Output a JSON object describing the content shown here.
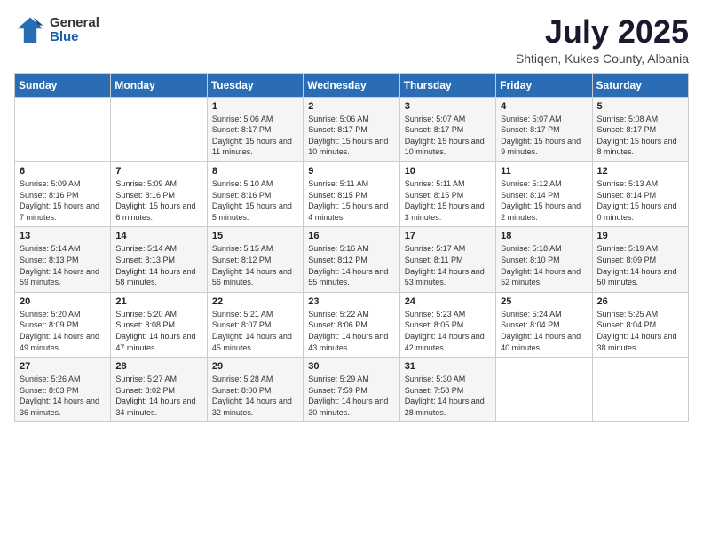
{
  "header": {
    "logo_general": "General",
    "logo_blue": "Blue",
    "month_title": "July 2025",
    "location": "Shtiqen, Kukes County, Albania"
  },
  "weekdays": [
    "Sunday",
    "Monday",
    "Tuesday",
    "Wednesday",
    "Thursday",
    "Friday",
    "Saturday"
  ],
  "weeks": [
    [
      {
        "day": "",
        "sunrise": "",
        "sunset": "",
        "daylight": ""
      },
      {
        "day": "",
        "sunrise": "",
        "sunset": "",
        "daylight": ""
      },
      {
        "day": "1",
        "sunrise": "Sunrise: 5:06 AM",
        "sunset": "Sunset: 8:17 PM",
        "daylight": "Daylight: 15 hours and 11 minutes."
      },
      {
        "day": "2",
        "sunrise": "Sunrise: 5:06 AM",
        "sunset": "Sunset: 8:17 PM",
        "daylight": "Daylight: 15 hours and 10 minutes."
      },
      {
        "day": "3",
        "sunrise": "Sunrise: 5:07 AM",
        "sunset": "Sunset: 8:17 PM",
        "daylight": "Daylight: 15 hours and 10 minutes."
      },
      {
        "day": "4",
        "sunrise": "Sunrise: 5:07 AM",
        "sunset": "Sunset: 8:17 PM",
        "daylight": "Daylight: 15 hours and 9 minutes."
      },
      {
        "day": "5",
        "sunrise": "Sunrise: 5:08 AM",
        "sunset": "Sunset: 8:17 PM",
        "daylight": "Daylight: 15 hours and 8 minutes."
      }
    ],
    [
      {
        "day": "6",
        "sunrise": "Sunrise: 5:09 AM",
        "sunset": "Sunset: 8:16 PM",
        "daylight": "Daylight: 15 hours and 7 minutes."
      },
      {
        "day": "7",
        "sunrise": "Sunrise: 5:09 AM",
        "sunset": "Sunset: 8:16 PM",
        "daylight": "Daylight: 15 hours and 6 minutes."
      },
      {
        "day": "8",
        "sunrise": "Sunrise: 5:10 AM",
        "sunset": "Sunset: 8:16 PM",
        "daylight": "Daylight: 15 hours and 5 minutes."
      },
      {
        "day": "9",
        "sunrise": "Sunrise: 5:11 AM",
        "sunset": "Sunset: 8:15 PM",
        "daylight": "Daylight: 15 hours and 4 minutes."
      },
      {
        "day": "10",
        "sunrise": "Sunrise: 5:11 AM",
        "sunset": "Sunset: 8:15 PM",
        "daylight": "Daylight: 15 hours and 3 minutes."
      },
      {
        "day": "11",
        "sunrise": "Sunrise: 5:12 AM",
        "sunset": "Sunset: 8:14 PM",
        "daylight": "Daylight: 15 hours and 2 minutes."
      },
      {
        "day": "12",
        "sunrise": "Sunrise: 5:13 AM",
        "sunset": "Sunset: 8:14 PM",
        "daylight": "Daylight: 15 hours and 0 minutes."
      }
    ],
    [
      {
        "day": "13",
        "sunrise": "Sunrise: 5:14 AM",
        "sunset": "Sunset: 8:13 PM",
        "daylight": "Daylight: 14 hours and 59 minutes."
      },
      {
        "day": "14",
        "sunrise": "Sunrise: 5:14 AM",
        "sunset": "Sunset: 8:13 PM",
        "daylight": "Daylight: 14 hours and 58 minutes."
      },
      {
        "day": "15",
        "sunrise": "Sunrise: 5:15 AM",
        "sunset": "Sunset: 8:12 PM",
        "daylight": "Daylight: 14 hours and 56 minutes."
      },
      {
        "day": "16",
        "sunrise": "Sunrise: 5:16 AM",
        "sunset": "Sunset: 8:12 PM",
        "daylight": "Daylight: 14 hours and 55 minutes."
      },
      {
        "day": "17",
        "sunrise": "Sunrise: 5:17 AM",
        "sunset": "Sunset: 8:11 PM",
        "daylight": "Daylight: 14 hours and 53 minutes."
      },
      {
        "day": "18",
        "sunrise": "Sunrise: 5:18 AM",
        "sunset": "Sunset: 8:10 PM",
        "daylight": "Daylight: 14 hours and 52 minutes."
      },
      {
        "day": "19",
        "sunrise": "Sunrise: 5:19 AM",
        "sunset": "Sunset: 8:09 PM",
        "daylight": "Daylight: 14 hours and 50 minutes."
      }
    ],
    [
      {
        "day": "20",
        "sunrise": "Sunrise: 5:20 AM",
        "sunset": "Sunset: 8:09 PM",
        "daylight": "Daylight: 14 hours and 49 minutes."
      },
      {
        "day": "21",
        "sunrise": "Sunrise: 5:20 AM",
        "sunset": "Sunset: 8:08 PM",
        "daylight": "Daylight: 14 hours and 47 minutes."
      },
      {
        "day": "22",
        "sunrise": "Sunrise: 5:21 AM",
        "sunset": "Sunset: 8:07 PM",
        "daylight": "Daylight: 14 hours and 45 minutes."
      },
      {
        "day": "23",
        "sunrise": "Sunrise: 5:22 AM",
        "sunset": "Sunset: 8:06 PM",
        "daylight": "Daylight: 14 hours and 43 minutes."
      },
      {
        "day": "24",
        "sunrise": "Sunrise: 5:23 AM",
        "sunset": "Sunset: 8:05 PM",
        "daylight": "Daylight: 14 hours and 42 minutes."
      },
      {
        "day": "25",
        "sunrise": "Sunrise: 5:24 AM",
        "sunset": "Sunset: 8:04 PM",
        "daylight": "Daylight: 14 hours and 40 minutes."
      },
      {
        "day": "26",
        "sunrise": "Sunrise: 5:25 AM",
        "sunset": "Sunset: 8:04 PM",
        "daylight": "Daylight: 14 hours and 38 minutes."
      }
    ],
    [
      {
        "day": "27",
        "sunrise": "Sunrise: 5:26 AM",
        "sunset": "Sunset: 8:03 PM",
        "daylight": "Daylight: 14 hours and 36 minutes."
      },
      {
        "day": "28",
        "sunrise": "Sunrise: 5:27 AM",
        "sunset": "Sunset: 8:02 PM",
        "daylight": "Daylight: 14 hours and 34 minutes."
      },
      {
        "day": "29",
        "sunrise": "Sunrise: 5:28 AM",
        "sunset": "Sunset: 8:00 PM",
        "daylight": "Daylight: 14 hours and 32 minutes."
      },
      {
        "day": "30",
        "sunrise": "Sunrise: 5:29 AM",
        "sunset": "Sunset: 7:59 PM",
        "daylight": "Daylight: 14 hours and 30 minutes."
      },
      {
        "day": "31",
        "sunrise": "Sunrise: 5:30 AM",
        "sunset": "Sunset: 7:58 PM",
        "daylight": "Daylight: 14 hours and 28 minutes."
      },
      {
        "day": "",
        "sunrise": "",
        "sunset": "",
        "daylight": ""
      },
      {
        "day": "",
        "sunrise": "",
        "sunset": "",
        "daylight": ""
      }
    ]
  ]
}
